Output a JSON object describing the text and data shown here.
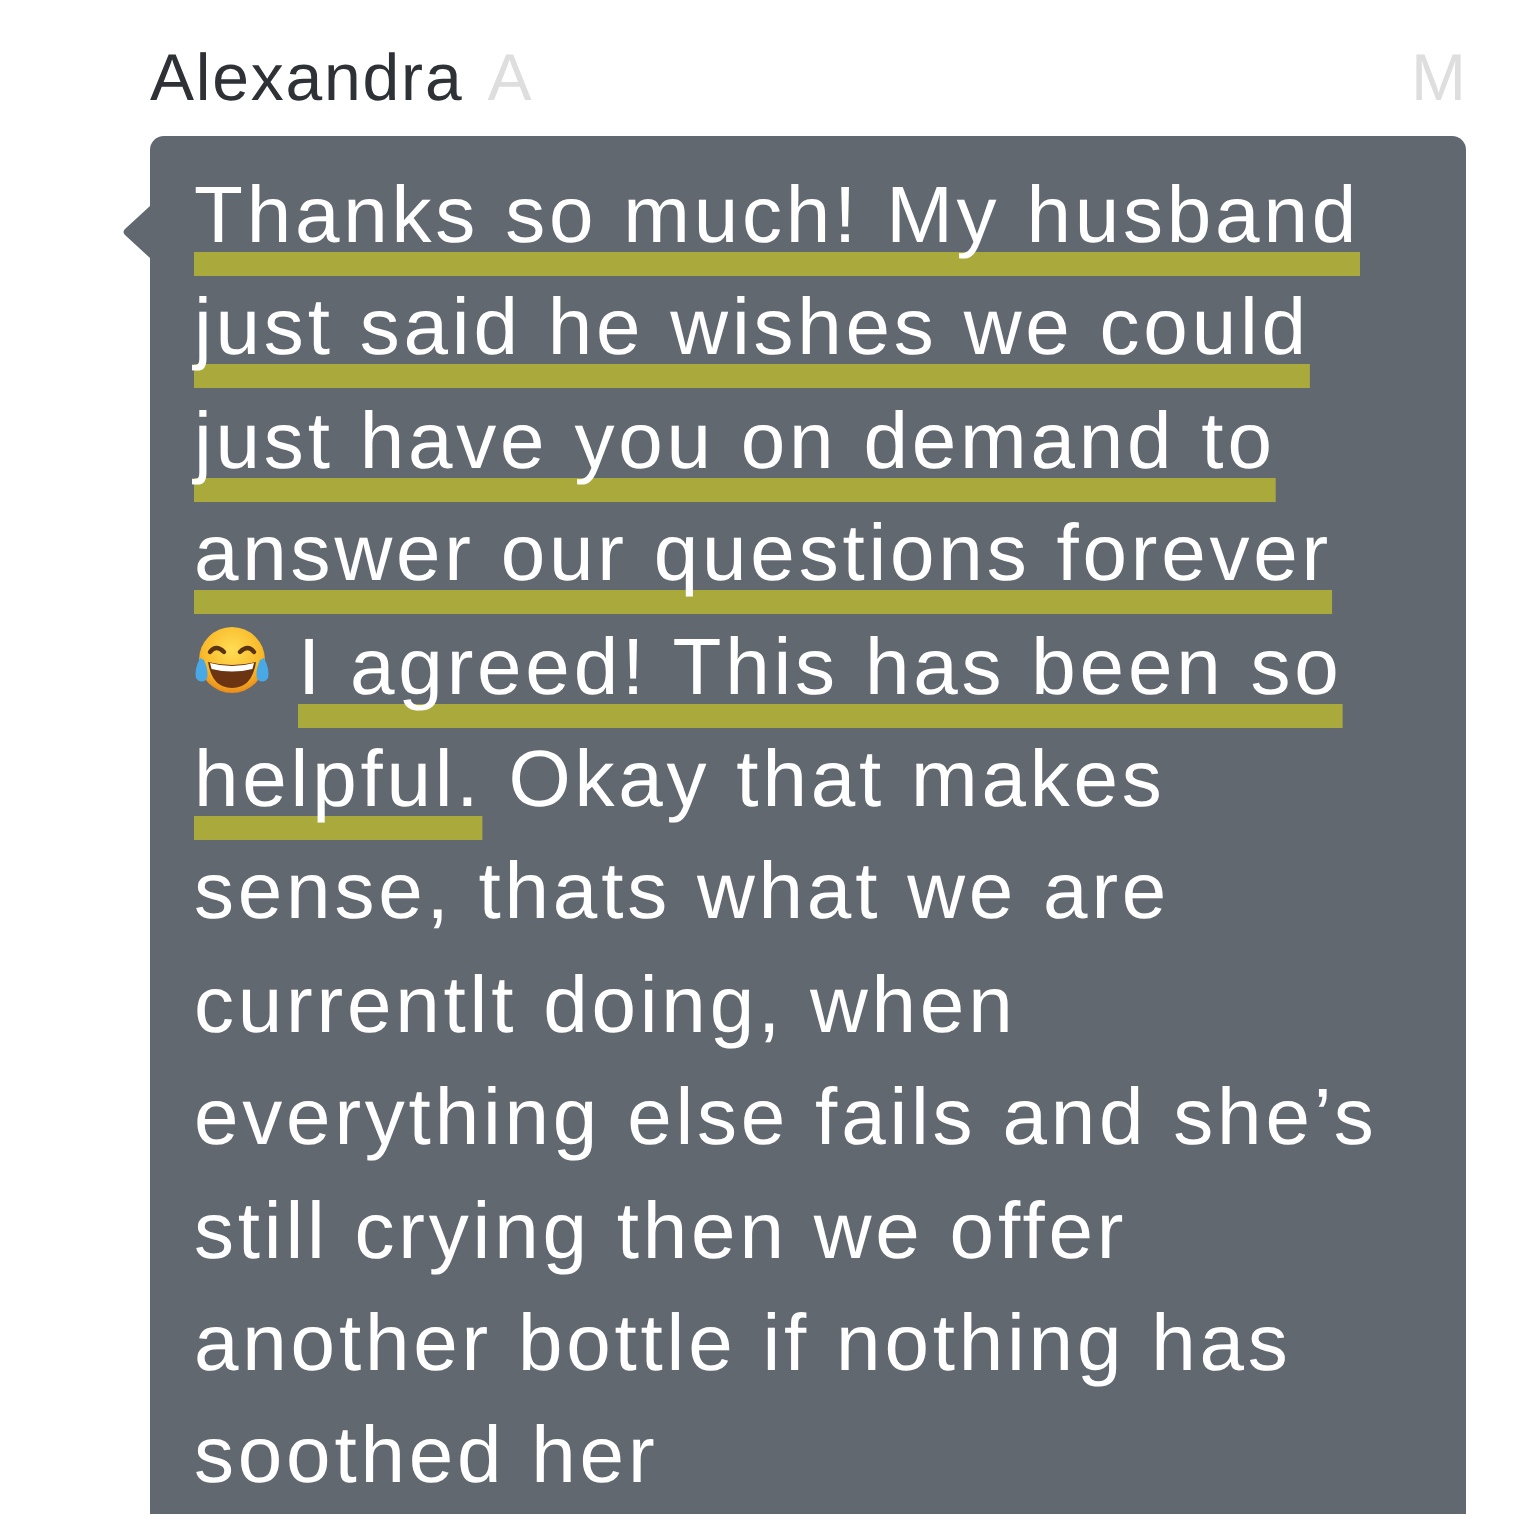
{
  "header": {
    "sender": "Alexandra",
    "surname_fragment": "A",
    "time_fragment": "M"
  },
  "message": {
    "parts": [
      {
        "text": "Thanks so much! My husband just said he wishes we could just have you on demand to answer our questions forever",
        "highlighted": true
      },
      {
        "text": "I agreed! This has been so",
        "highlighted": true
      },
      {
        "text": "helpful.",
        "highlighted": true
      },
      {
        "text": "Okay that makes sense, thats what we are currentlt doing, when everything else fails and she’s still crying then we offer another bottle if nothing has soothed her",
        "highlighted": false
      }
    ]
  }
}
